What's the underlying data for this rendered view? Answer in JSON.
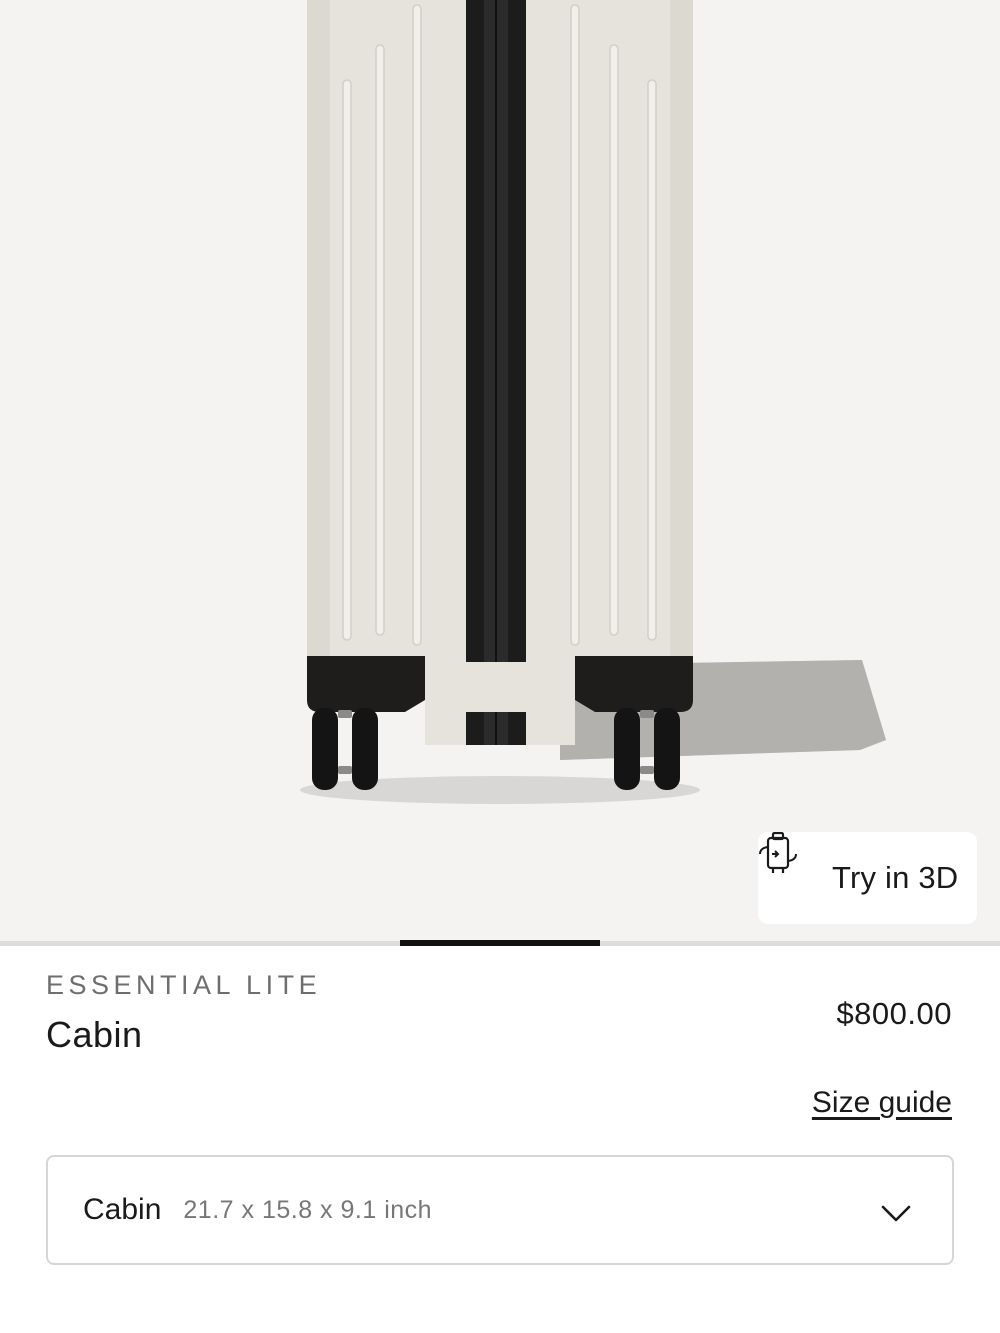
{
  "product_image": {
    "alt_icon": "suitcase-image",
    "try3d_label": "Try in 3D",
    "try3d_icon": "suitcase-3d-icon"
  },
  "carousel": {
    "current": 2,
    "total": 5
  },
  "product": {
    "collection": "ESSENTIAL LITE",
    "name": "Cabin",
    "price": "$800.00"
  },
  "size_guide_label": "Size guide",
  "size_select": {
    "selected_name": "Cabin",
    "selected_dims": "21.7 x 15.8 x 9.1 inch",
    "chevron_icon": "chevron-down-icon"
  },
  "colors": {
    "accent": "#111111",
    "hero_bg": "#f4f3f1",
    "shell": "#e4e1da"
  }
}
